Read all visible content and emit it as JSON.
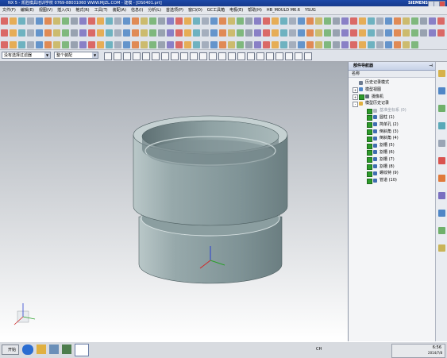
{
  "window": {
    "title": "NX 5 - 凯胜模具培训学校    0769-88031060    WWW.MJZL.COM - 建模 - [DS0401.prt]",
    "brand": "SIEMENS"
  },
  "menu": [
    "文件(F)",
    "编辑(E)",
    "视图(V)",
    "插入(S)",
    "格式(R)",
    "工具(T)",
    "装配(A)",
    "信息(I)",
    "分析(L)",
    "首选项(P)",
    "窗口(O)",
    "GC工具箱",
    "电极(E)",
    "帮助(H)",
    "HB_MOULD M6.6",
    "YSUG"
  ],
  "selection_bar": {
    "filter": "没有选择过滤器",
    "scope": "整个装配"
  },
  "navigator": {
    "title": "部件导航器",
    "pin_icon": "⊣",
    "column_header": "名称",
    "items": [
      {
        "label": "历史记录模式",
        "icon": "clock-icon",
        "indent": 0,
        "expander": "",
        "check": false
      },
      {
        "label": "模型视图",
        "icon": "view-icon",
        "indent": 0,
        "expander": "+",
        "check": false
      },
      {
        "label": "摄像机",
        "icon": "camera-icon",
        "indent": 0,
        "expander": "+",
        "check": true
      },
      {
        "label": "模型历史记录",
        "icon": "folder-icon",
        "indent": 0,
        "expander": "-",
        "check": false
      },
      {
        "label": "基准坐标系 (0)",
        "icon": "csys-icon",
        "indent": 1,
        "expander": "",
        "check": true,
        "dim": true
      },
      {
        "label": "圆柱 (1)",
        "icon": "cylinder-icon",
        "indent": 1,
        "expander": "",
        "check": true
      },
      {
        "label": "简单孔 (2)",
        "icon": "hole-icon",
        "indent": 1,
        "expander": "",
        "check": true
      },
      {
        "label": "倒斜角 (3)",
        "icon": "chamfer-icon",
        "indent": 1,
        "expander": "",
        "check": true
      },
      {
        "label": "倒斜角 (4)",
        "icon": "chamfer-icon",
        "indent": 1,
        "expander": "",
        "check": true
      },
      {
        "label": "割槽 (5)",
        "icon": "groove-icon",
        "indent": 1,
        "expander": "",
        "check": true
      },
      {
        "label": "割槽 (6)",
        "icon": "groove-icon",
        "indent": 1,
        "expander": "",
        "check": true
      },
      {
        "label": "割槽 (7)",
        "icon": "groove-icon",
        "indent": 1,
        "expander": "",
        "check": true
      },
      {
        "label": "割槽 (8)",
        "icon": "groove-icon",
        "indent": 1,
        "expander": "",
        "check": true
      },
      {
        "label": "螺纹特 (9)",
        "icon": "thread-icon",
        "indent": 1,
        "expander": "",
        "check": true
      },
      {
        "label": "管道 (10)",
        "icon": "tube-icon",
        "indent": 1,
        "expander": "",
        "check": true
      }
    ]
  },
  "taskbar": {
    "start": "开始",
    "time": "6:56",
    "date": "2014/7/8",
    "lang": "CH"
  },
  "colors": {
    "title_bar": "#1d49a8",
    "part_body": "#7f9396",
    "part_light": "#b9c7c8",
    "check_green": "#2c9a2a"
  }
}
